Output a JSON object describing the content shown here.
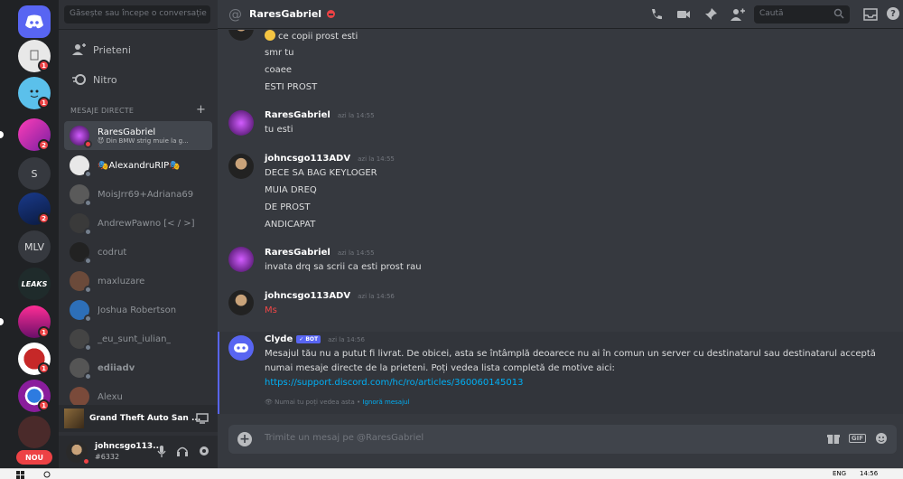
{
  "guilds": {
    "unread_badges": [
      "1",
      "1",
      "2",
      "2",
      "1",
      "1",
      "1"
    ],
    "server_s_label": "S",
    "server_mlv_label": "MLV",
    "server_leaks_label": "LEAKS",
    "new_label": "NOU"
  },
  "sidebar": {
    "search_placeholder": "Găsește sau începe o conversație",
    "nav": [
      {
        "label": "Prieteni",
        "icon": "friends-icon"
      },
      {
        "label": "Nitro",
        "icon": "nitro-icon"
      }
    ],
    "dm_header": "MESAJE DIRECTE",
    "dms": [
      {
        "name": "RaresGabriel",
        "status_text": "😈 Din BMW strig muie la g...",
        "active": true
      },
      {
        "name": "🎭AlexandruRIP🎭",
        "active": false
      },
      {
        "name": "MoisJrr69+Adriana69",
        "active": false
      },
      {
        "name": "AndrewPawno [< / >]",
        "active": false
      },
      {
        "name": "codrut",
        "active": false
      },
      {
        "name": "maxluzare",
        "active": false
      },
      {
        "name": "Joshua Robertson",
        "active": false
      },
      {
        "name": "_eu_sunt_iulian_",
        "active": false
      },
      {
        "name": "ediiadv",
        "active": false
      },
      {
        "name": "Alexu",
        "active": false
      }
    ],
    "activity": "Grand Theft Auto San ...",
    "user": {
      "name": "johncsgo113...",
      "tag": "#6332"
    }
  },
  "chat": {
    "channel_title": "RaresGabriel",
    "search_placeholder": "Caută",
    "messages": [
      {
        "lines": [
          "ce copii prost esti",
          "smr tu",
          "coaee",
          "ESTI PROST"
        ]
      },
      {
        "author": "RaresGabriel",
        "time": "azi la 14:55",
        "lines": [
          "tu esti"
        ]
      },
      {
        "author": "johncsgo113ADV",
        "time": "azi la 14:55",
        "lines": [
          "DECE SA BAG KEYLOGER",
          "MUIA DREQ",
          "DE PROST",
          "ANDICAPAT"
        ]
      },
      {
        "author": "RaresGabriel",
        "time": "azi la 14:55",
        "lines": [
          "invata drq sa scrii ca esti prost rau"
        ]
      },
      {
        "author": "johncsgo113ADV",
        "time": "azi la 14:56",
        "lines": [
          "Ms"
        ]
      }
    ],
    "clyde": {
      "author": "Clyde",
      "bot_tag": "BOT",
      "time": "azi la 14:56",
      "text1": "Mesajul tău nu a putut fi livrat. De obicei, asta se întâmplă deoarece nu ai în comun un server cu destinatarul sau destinatarul acceptă",
      "text2": "numai mesaje directe de la prieteni. Poți vedea lista completă de motive aici:",
      "link": "https://support.discord.com/hc/ro/articles/360060145013",
      "footer": "Numai tu poți vedea asta",
      "dismiss": "Ignoră mesajul"
    },
    "composer_placeholder": "Trimite un mesaj pe @RaresGabriel",
    "gif_label": "GIF"
  },
  "taskbar": {
    "lang": "ENG",
    "time": "14:56"
  },
  "colors": {
    "accent": "#5865f2",
    "dnd": "#ed4245",
    "link": "#00aff4",
    "ms_red": "#f04747"
  }
}
